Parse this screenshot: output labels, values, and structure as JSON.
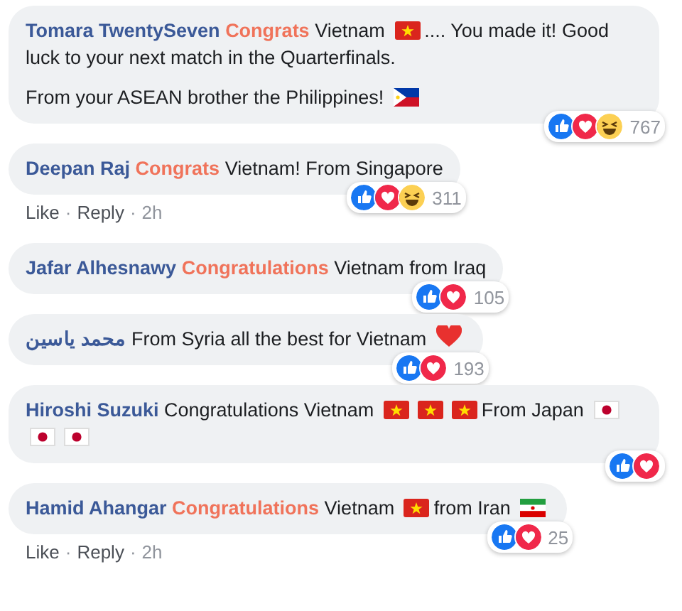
{
  "comments": [
    {
      "author": "Tomara TwentySeven",
      "paragraphs": [
        [
          {
            "kind": "text",
            "text": "**Congrats** Vietnam"
          },
          {
            "kind": "vn-flag"
          },
          {
            "kind": "text",
            "text": ".... You made it! Good"
          },
          {
            "kind": "text",
            "text": "luck to your next match in the Quarterfinals."
          }
        ],
        [
          {
            "kind": "text",
            "text": "From your ASEAN brother the Philippines!"
          },
          {
            "kind": "ph-flag"
          }
        ]
      ],
      "reactions": {
        "icons": [
          {
            "kind": "like"
          },
          {
            "kind": "love"
          },
          {
            "kind": "haha"
          }
        ],
        "count": "767"
      }
    },
    {
      "author": "Deepan Raj",
      "paragraphs": [
        [
          {
            "kind": "text",
            "text": "**Congrats** Vietnam! From Singapore"
          }
        ]
      ],
      "reactions": {
        "icons": [
          {
            "kind": "like"
          },
          {
            "kind": "love"
          },
          {
            "kind": "haha"
          }
        ],
        "count": "311"
      },
      "footer": {
        "like": "Like",
        "reply": "Reply",
        "time": "2h",
        "separator": "·"
      }
    },
    {
      "author": "Jafar Alhesnawy",
      "paragraphs": [
        [
          {
            "kind": "text",
            "text": "**Congratulations** Vietnam from Iraq"
          }
        ]
      ],
      "reactions": {
        "icons": [
          {
            "kind": "like"
          },
          {
            "kind": "love"
          }
        ],
        "count": "105"
      }
    },
    {
      "author": "محمد ياسين",
      "paragraphs": [
        [
          {
            "kind": "text",
            "text": "From Syria all the best for Vietnam"
          },
          {
            "kind": "heart"
          }
        ]
      ],
      "reactions": {
        "icons": [
          {
            "kind": "like"
          },
          {
            "kind": "love"
          }
        ],
        "count": "193"
      }
    },
    {
      "author": "Hiroshi Suzuki",
      "paragraphs": [
        [
          {
            "kind": "text",
            "text": "Congratulations Vietnam"
          },
          {
            "kind": "vn-flag"
          },
          {
            "kind": "vn-flag"
          },
          {
            "kind": "vn-flag"
          },
          {
            "kind": "text",
            "text": "From Japan"
          },
          {
            "kind": "jp-flag"
          },
          {
            "kind": "jp-flag"
          },
          {
            "kind": "jp-flag"
          }
        ]
      ],
      "reactions": {
        "icons": [
          {
            "kind": "like"
          },
          {
            "kind": "love"
          }
        ]
      }
    },
    {
      "author": "Hamid Ahangar",
      "paragraphs": [
        [
          {
            "kind": "text",
            "text": "**Congratulations** Vietnam"
          },
          {
            "kind": "vn-flag"
          },
          {
            "kind": "text",
            "text": "from Iran"
          },
          {
            "kind": "ir-flag"
          }
        ]
      ],
      "reactions": {
        "icons": [
          {
            "kind": "like"
          },
          {
            "kind": "love"
          }
        ],
        "count": "25"
      },
      "footer": {
        "like": "Like",
        "reply": "Reply",
        "time": "2h",
        "separator": "·"
      }
    }
  ]
}
